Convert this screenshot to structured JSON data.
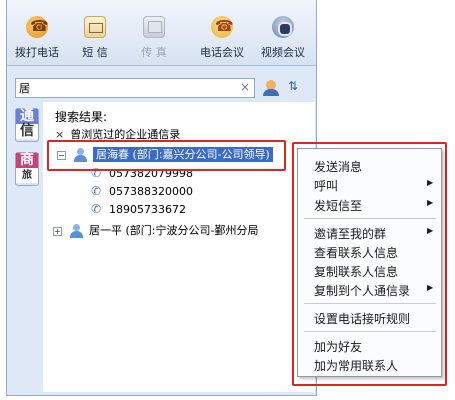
{
  "toolbar": {
    "items": [
      {
        "label": "拨打电话",
        "icon": "phone-icon"
      },
      {
        "label": "短 信",
        "icon": "sms-icon"
      },
      {
        "label": "传 真",
        "icon": "fax-icon"
      },
      {
        "label": "电话会议",
        "icon": "conference-call-icon"
      },
      {
        "label": "视频会议",
        "icon": "video-conference-icon"
      }
    ]
  },
  "search": {
    "value": "居",
    "clear_icon": "×"
  },
  "side_tabs": [
    {
      "top": "通",
      "bottom": "信"
    },
    {
      "top": "商",
      "bottom": "旅"
    }
  ],
  "results": {
    "title": "搜索结果:",
    "group_label": "曾浏览过的企业通信录",
    "group_marker": "×",
    "contacts": [
      {
        "name": "居海春",
        "dept": "(部门:嘉兴分公司-公司领导)",
        "expanded": true,
        "selected": true,
        "phones": [
          "057382079998",
          "057388320000",
          "18905733672"
        ]
      },
      {
        "name": "居一平",
        "dept": "(部门:宁波分公司-鄞州分局",
        "expanded": false,
        "selected": false
      }
    ],
    "expand_minus": "−",
    "expand_plus": "+"
  },
  "context_menu": {
    "items": [
      {
        "label": "发送消息",
        "submenu": false
      },
      {
        "label": "呼叫",
        "submenu": true
      },
      {
        "label": "发短信至",
        "submenu": true
      },
      {
        "label": "邀请至我的群",
        "submenu": true
      },
      {
        "label": "查看联系人信息",
        "submenu": false
      },
      {
        "label": "复制联系人信息",
        "submenu": false
      },
      {
        "label": "复制到个人通信录",
        "submenu": true
      },
      {
        "label": "设置电话接听规则",
        "submenu": false
      },
      {
        "label": "加为好友",
        "submenu": false
      },
      {
        "label": "加为常用联系人",
        "submenu": false
      }
    ],
    "arrow": "▶"
  },
  "colors": {
    "highlight": "#e0241f",
    "selection": "#3a6cc6"
  }
}
